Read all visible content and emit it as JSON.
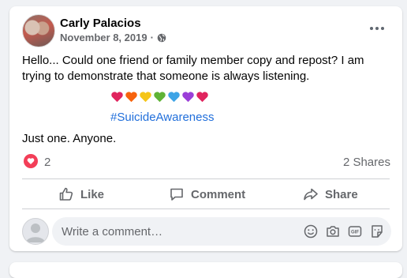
{
  "post": {
    "author": "Carly Palacios",
    "date": "November 8, 2019",
    "separator": "·",
    "privacy_icon": "globe-icon",
    "body_text": "Hello... Could one friend or family member copy and repost? I am trying to demonstrate that someone is always listening.",
    "emoji_hearts": [
      "#e0245e",
      "#f7630c",
      "#f5c518",
      "#5fb336",
      "#3ea4e6",
      "#9b3fd8",
      "#e0245e"
    ],
    "hashtag": "#SuicideAwareness",
    "closing_text": "Just one. Anyone."
  },
  "stats": {
    "reaction_icon": "love-reaction-icon",
    "reaction_count": "2",
    "shares": "2 Shares"
  },
  "actions": {
    "like": "Like",
    "comment": "Comment",
    "share": "Share"
  },
  "comment_box": {
    "placeholder": "Write a comment…",
    "icons": [
      "emoji-icon",
      "camera-icon",
      "gif-icon",
      "sticker-icon"
    ]
  },
  "colors": {
    "link": "#216fdb",
    "reaction": "#f33e58",
    "muted": "#65676b"
  }
}
